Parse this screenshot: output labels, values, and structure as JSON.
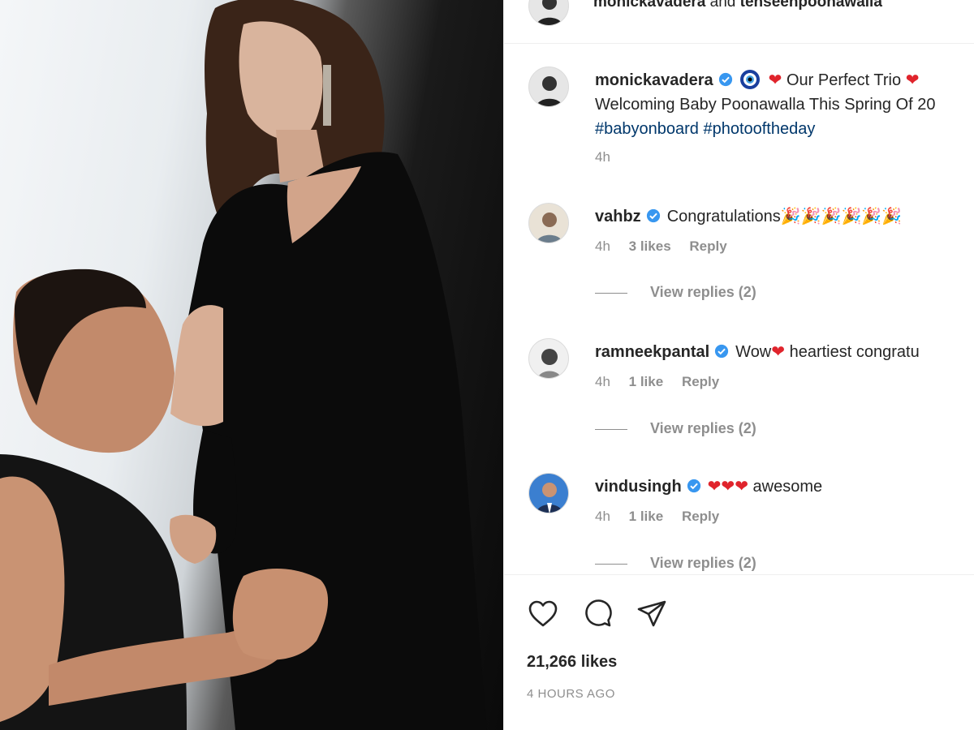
{
  "header": {
    "user1": "monickavadera",
    "and_text": "and",
    "user2": "tenseenpoonawalla"
  },
  "caption": {
    "username": "monickavadera",
    "text_line1": "Our Perfect Trio",
    "text_line2": "Welcoming Baby Poonawalla This Spring Of 20",
    "hashtag1": "#babyonboard",
    "hashtag2": "#photooftheday",
    "time": "4h"
  },
  "comments": [
    {
      "username": "vahbz",
      "text": "Congratulations",
      "emoji": "🎉🎉🎉🎉🎉🎉",
      "time": "4h",
      "likes": "3 likes",
      "reply": "Reply",
      "view_replies": "View replies (2)"
    },
    {
      "username": "ramneekpantal",
      "text_before": "Wow",
      "text_after": "heartiest congratu",
      "time": "4h",
      "likes": "1 like",
      "reply": "Reply",
      "view_replies": "View replies (2)"
    },
    {
      "username": "vindusingh",
      "text": "awesome",
      "time": "4h",
      "likes": "1 like",
      "reply": "Reply",
      "view_replies": "View replies (2)"
    }
  ],
  "actions": {
    "like_icon": "heart-icon",
    "comment_icon": "comment-icon",
    "share_icon": "share-icon"
  },
  "likes_count": "21,266 likes",
  "post_time": "4 HOURS AGO",
  "colors": {
    "verified": "#3897f0",
    "heart": "#e0242c",
    "hashtag": "#00376b",
    "meta": "#8e8e8e"
  }
}
